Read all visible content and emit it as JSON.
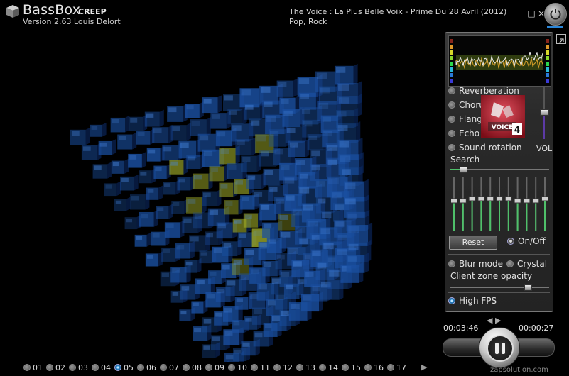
{
  "app": {
    "title": "BassBox",
    "subtitle": "CREEP",
    "version": "Version 2.63  Louis Delort"
  },
  "now_playing": {
    "title": "The Voice : La Plus Belle Voix - Prime Du 28 Avril (2012)",
    "genre": "Pop, Rock"
  },
  "window_controls": {
    "minimize": "_",
    "maximize": "□",
    "close": "×"
  },
  "effects": [
    {
      "label": "Reverberation",
      "on": false
    },
    {
      "label": "Chorus",
      "on": false
    },
    {
      "label": "Flanger",
      "on": false
    },
    {
      "label": "Echo",
      "on": false
    },
    {
      "label": "Sound rotation",
      "on": false
    }
  ],
  "volume": {
    "label": "VOL",
    "level": 0.45
  },
  "search": {
    "label": "Search",
    "position": 0.15
  },
  "equalizer": {
    "bands": [
      0.45,
      0.45,
      0.5,
      0.5,
      0.5,
      0.5,
      0.5,
      0.45,
      0.45,
      0.45,
      0.5
    ],
    "reset_label": "Reset",
    "onoff_label": "On/Off"
  },
  "modes": {
    "blur_label": "Blur mode",
    "crystal_label": "Crystal",
    "opacity_label": "Client zone opacity",
    "opacity_value": 0.78,
    "high_fps_label": "High FPS"
  },
  "transport": {
    "elapsed": "00:03:46",
    "remaining": "00:00:27",
    "site": "zapsolution.com"
  },
  "tracks": [
    "01",
    "02",
    "03",
    "04",
    "05",
    "06",
    "07",
    "08",
    "09",
    "10",
    "11",
    "12",
    "13",
    "14",
    "15",
    "16",
    "17"
  ],
  "selected_track": "05",
  "colors": {
    "accent": "#2d8fd6",
    "viz_blue": "#1a4fa0",
    "viz_yellow": "#a6b22a"
  }
}
